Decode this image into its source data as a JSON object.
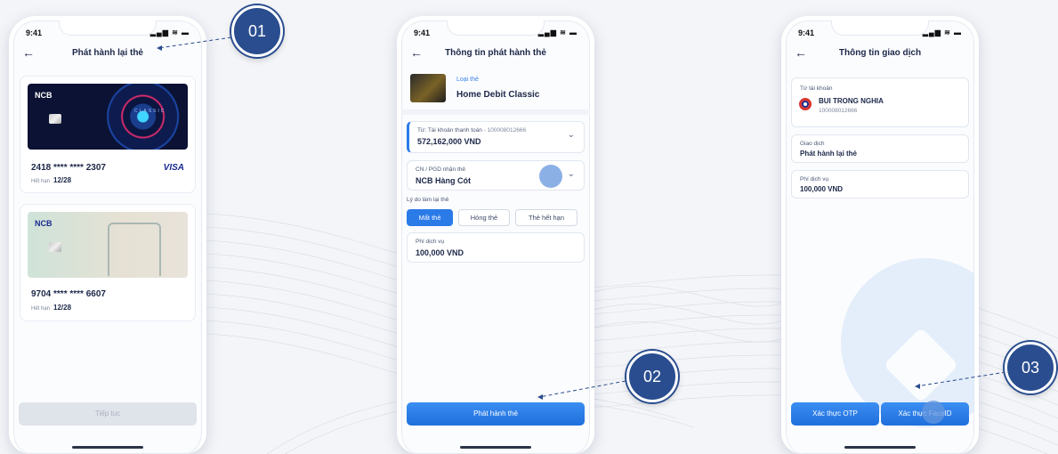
{
  "status": {
    "time": "9:41",
    "signal": "▂▄▆ ≋ ▬"
  },
  "callouts": [
    "01",
    "02",
    "03"
  ],
  "phone1": {
    "title": "Phát hành lại thẻ",
    "cards": [
      {
        "brand": "NCB",
        "label": "CLASSIC",
        "number": "2418 **** **** 2307",
        "exp_label": "Hết hạn",
        "exp": "12/28",
        "network": "VISA"
      },
      {
        "brand": "NCB",
        "number": "9704 **** **** 6607",
        "exp_label": "Hết hạn",
        "exp": "12/28"
      }
    ],
    "continue_label": "Tiếp tục"
  },
  "phone2": {
    "title": "Thông tin phát hành thẻ",
    "card_type_label": "Loại thẻ",
    "card_type_value": "Home Debit Classic",
    "from_label": "Từ: Tài khoản thanh toán",
    "from_account": "- 100008012666",
    "from_balance": "572,162,000 VND",
    "branch_label": "CN / PGD nhận thẻ",
    "branch_value": "NCB Hàng Cót",
    "reason_label": "Lý do làm lại thẻ",
    "reasons": [
      "Mất thẻ",
      "Hỏng thẻ",
      "Thẻ hết hạn"
    ],
    "selected_reason": "Mất thẻ",
    "fee_label": "Phí dịch vụ",
    "fee_value": "100,000 VND",
    "submit_label": "Phát hành thẻ"
  },
  "phone3": {
    "title": "Thông tin giao dịch",
    "from_label": "Từ tài khoản",
    "account_name": "BUI TRONG NGHIA",
    "account_number": "100008012666",
    "tx_label": "Giao dịch",
    "tx_value": "Phát hành lại thẻ",
    "fee_label": "Phí dịch vụ",
    "fee_value": "100,000 VND",
    "otp_label": "Xác thực OTP",
    "faceid_label": "Xác thực FaceID"
  }
}
